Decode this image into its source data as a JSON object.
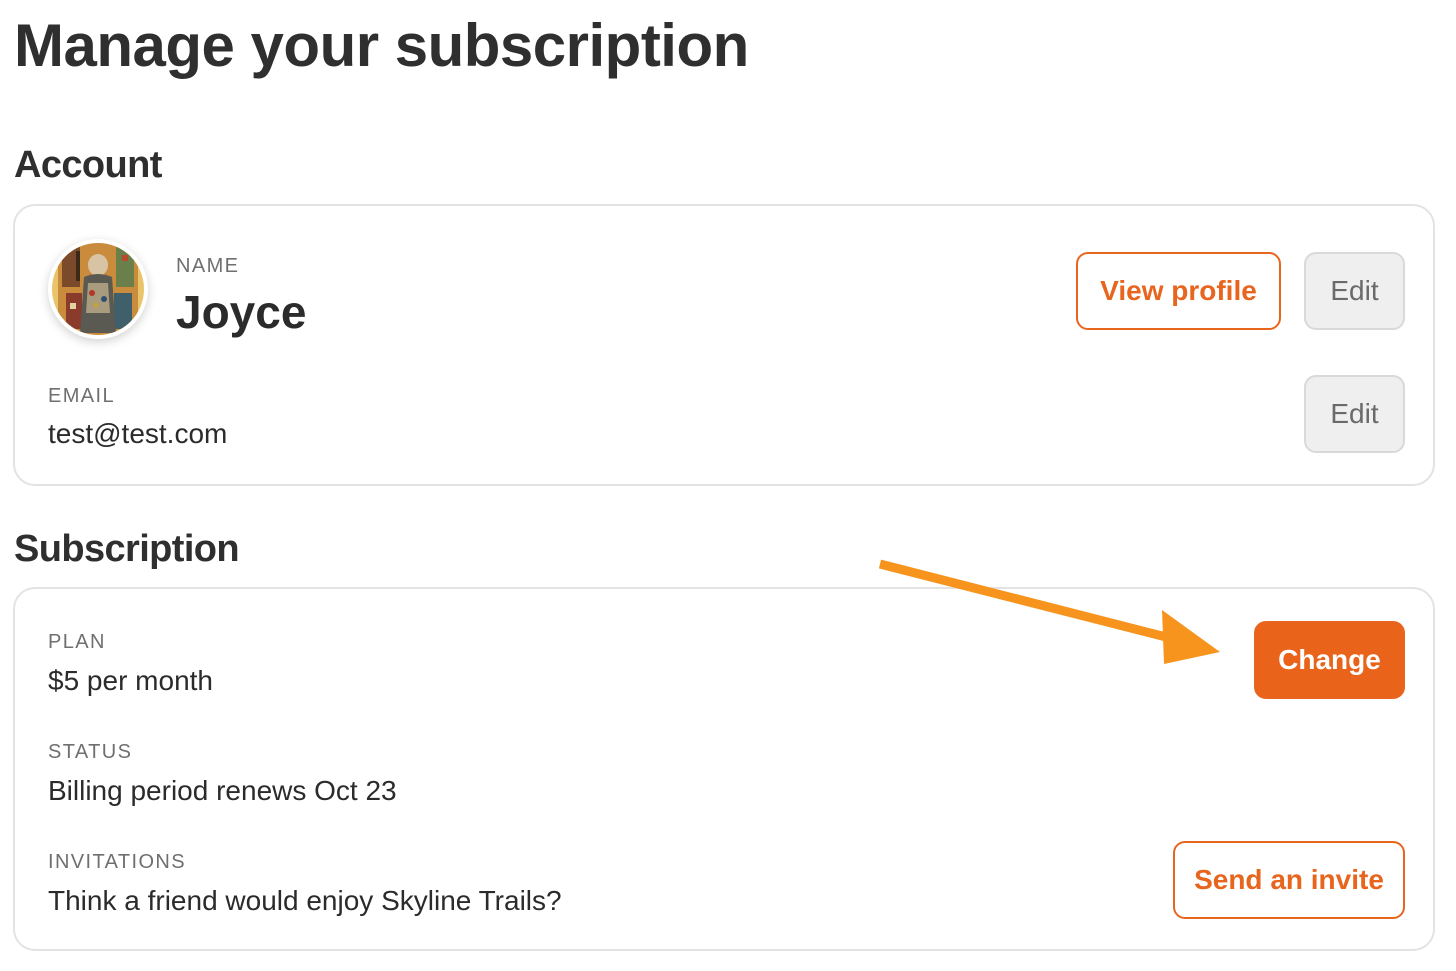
{
  "page": {
    "title": "Manage your subscription"
  },
  "account": {
    "heading": "Account",
    "name_label": "NAME",
    "name_value": "Joyce",
    "email_label": "EMAIL",
    "email_value": "test@test.com",
    "view_profile_label": "View profile",
    "edit_name_label": "Edit",
    "edit_email_label": "Edit"
  },
  "subscription": {
    "heading": "Subscription",
    "plan_label": "PLAN",
    "plan_value": "$5 per month",
    "change_label": "Change",
    "status_label": "STATUS",
    "status_value": "Billing period renews Oct 23",
    "invitations_label": "INVITATIONS",
    "invitations_value": "Think a friend would enjoy Skyline Trails?",
    "send_invite_label": "Send an invite"
  },
  "colors": {
    "accent": "#e9631a",
    "annotation_arrow": "#f7941d",
    "card_border": "#e3e3e3",
    "secondary_button_bg": "#efefef"
  },
  "icons": {
    "avatar": "avatar-image",
    "annotation": "arrow-annotation-icon"
  }
}
